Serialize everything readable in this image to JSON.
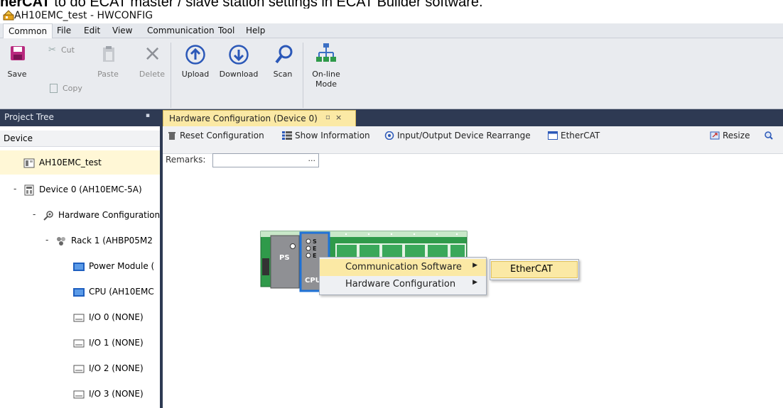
{
  "caption": {
    "bold": "herCAT",
    "rest": " to do ECAT master / slave station settings in ECAT Builder software."
  },
  "window": {
    "title": "AH10EMC_test - HWCONFIG"
  },
  "menu": {
    "items": [
      "Common",
      "File",
      "Edit",
      "View",
      "Communication",
      "Tool",
      "Help"
    ]
  },
  "ribbon": {
    "save": "Save",
    "cut": "Cut",
    "copy": "Copy",
    "paste": "Paste",
    "delete": "Delete",
    "upload": "Upload",
    "download": "Download",
    "scan": "Scan",
    "online_line1": "On-line",
    "online_line2": "Mode"
  },
  "project_tree": {
    "title": "Project Tree",
    "section": "Device",
    "items": [
      {
        "label": "AH10EMC_test",
        "icon": "project-icon"
      },
      {
        "label": "Device 0 (AH10EMC-5A)",
        "icon": "device-icon",
        "expander": "-"
      },
      {
        "label": "Hardware Configuration",
        "icon": "hardware-config-icon",
        "expander": "-"
      },
      {
        "label": "Rack 1 (AHBP05M2",
        "icon": "rack-icon",
        "expander": "-"
      },
      {
        "label": "Power Module (",
        "icon": "module-icon"
      },
      {
        "label": "CPU (AH10EMC",
        "icon": "module-icon"
      },
      {
        "label": "I/O 0 (NONE)",
        "icon": "slot-icon"
      },
      {
        "label": "I/O 1 (NONE)",
        "icon": "slot-icon"
      },
      {
        "label": "I/O 2 (NONE)",
        "icon": "slot-icon"
      },
      {
        "label": "I/O 3 (NONE)",
        "icon": "slot-icon"
      }
    ]
  },
  "doc_tab": {
    "label": "Hardware Configuration (Device 0)",
    "pin": "▫",
    "close": "×"
  },
  "toolbar": {
    "reset": "Reset Configuration",
    "show_info": "Show Information",
    "rearrange": "Input/Output Device Rearrange",
    "ethercat": "EtherCAT",
    "resize": "Resize"
  },
  "remarks": {
    "label": "Remarks:",
    "value": "",
    "dots": "..."
  },
  "rack": {
    "ps_label": "PS",
    "cpu_label": "CPU",
    "leds": [
      "S",
      "E",
      "E"
    ]
  },
  "context_menu": {
    "items": [
      "Communication Software",
      "Hardware Configuration"
    ],
    "submenu": [
      "EtherCAT"
    ]
  },
  "colors": {
    "accent": "#2e3a53",
    "highlight": "#fbe9a5",
    "rack_green": "#2f9a4a",
    "cpu_border": "#1f72d6"
  }
}
